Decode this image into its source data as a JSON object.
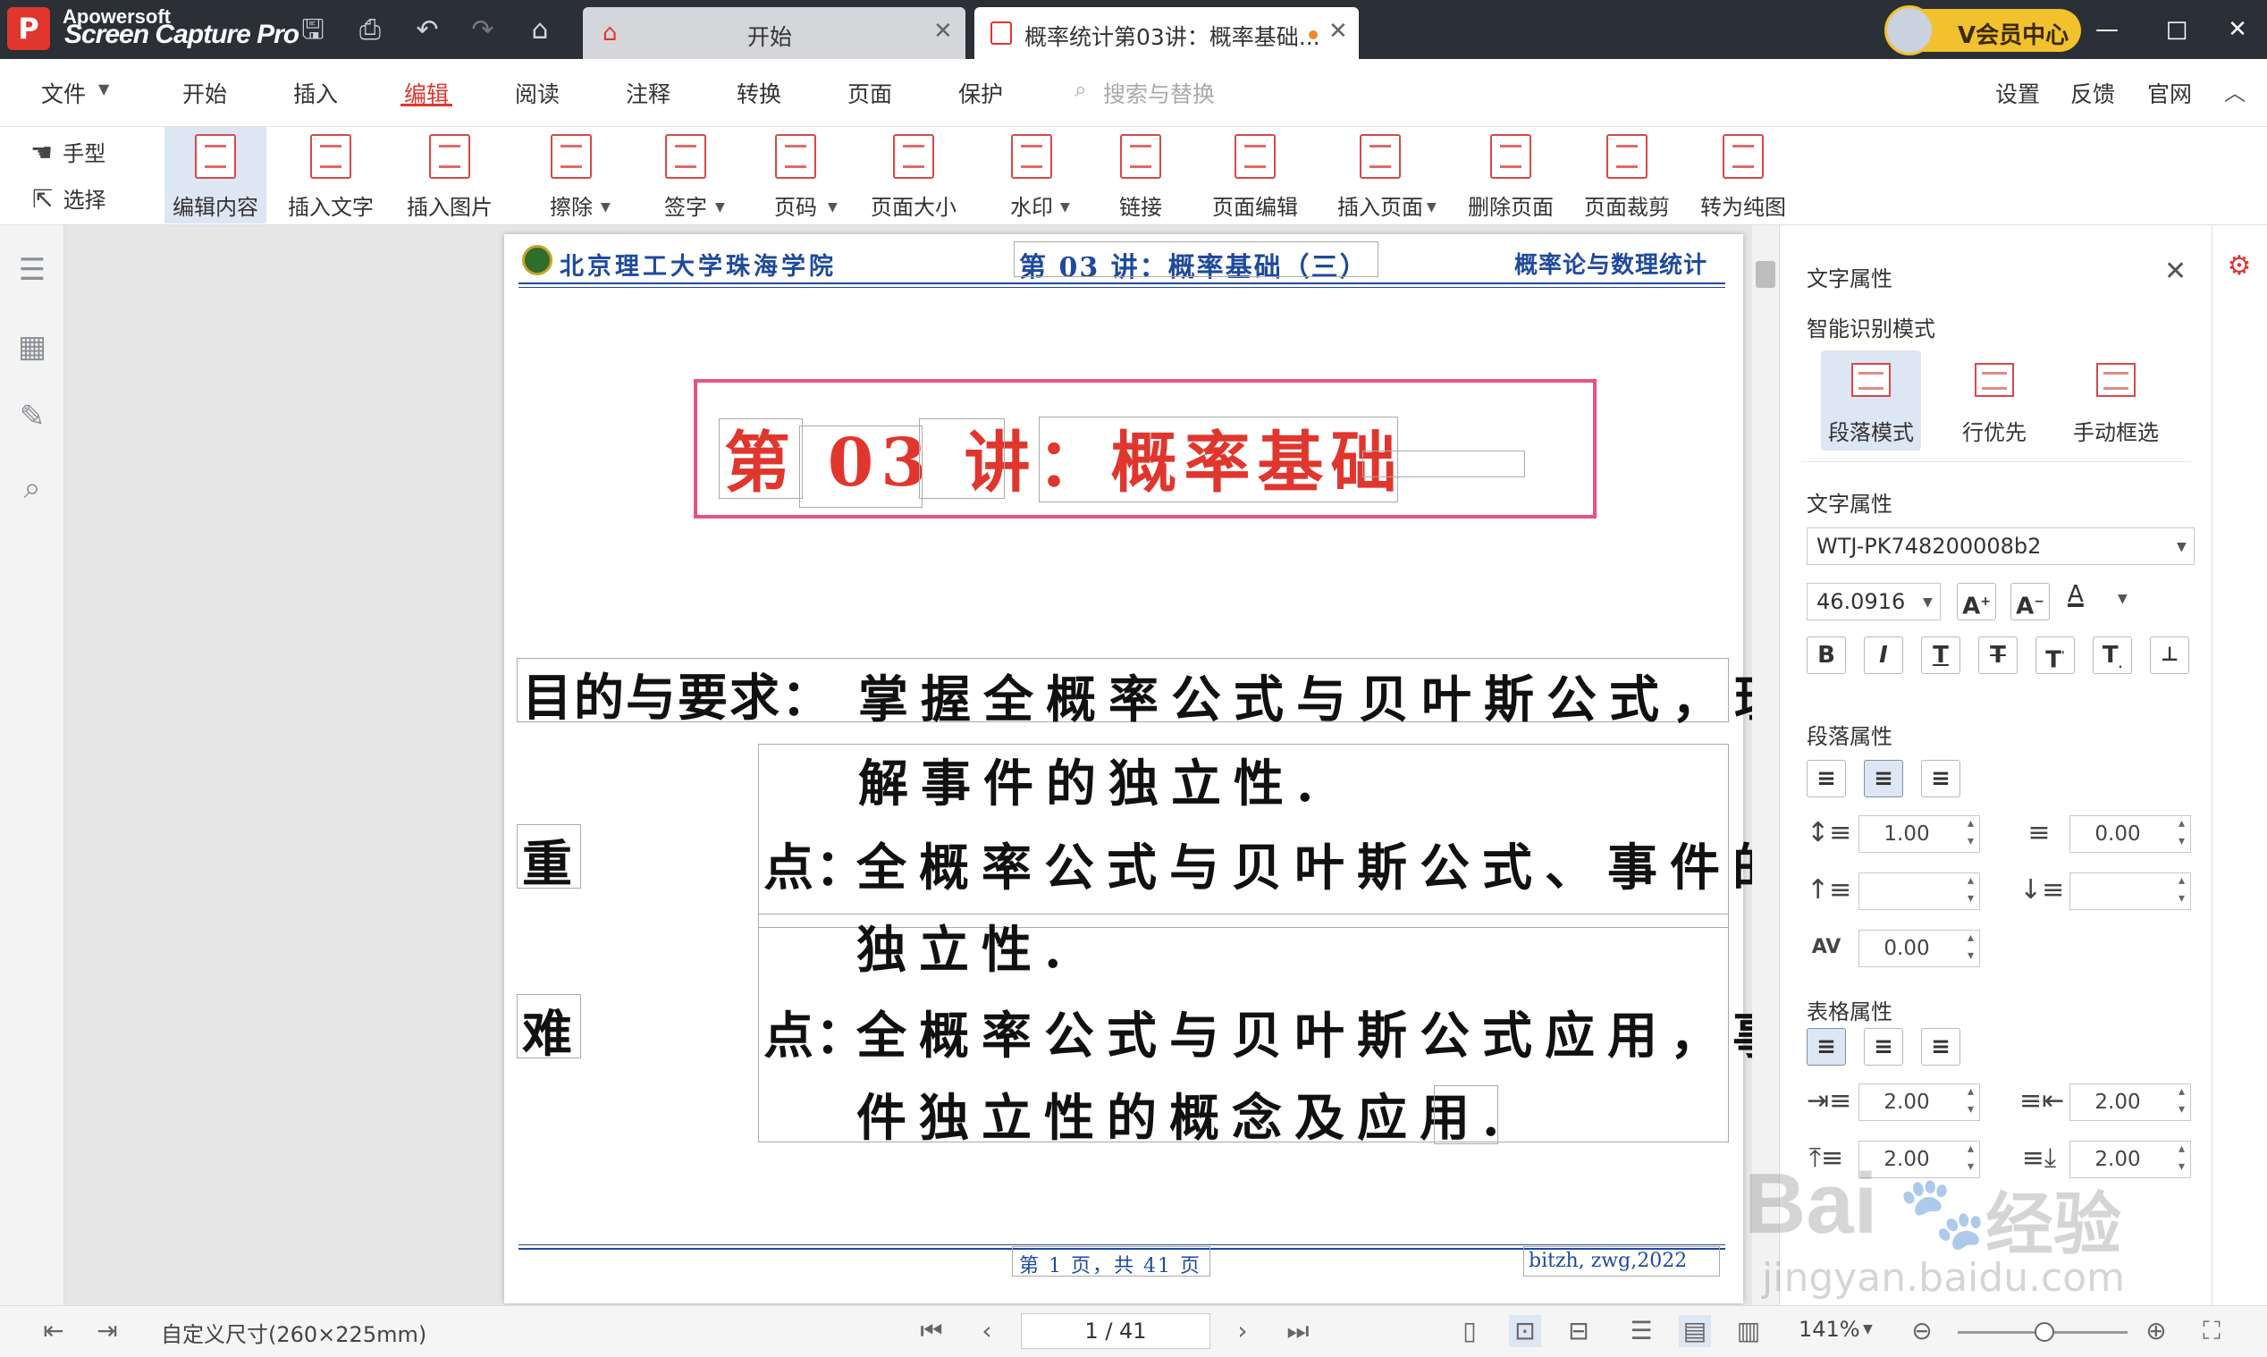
{
  "window": {
    "watermark_line1": "Apowersoft",
    "watermark_line2": "Screen Capture Pro",
    "tabs": [
      {
        "label": "开始"
      },
      {
        "label": "概率统计第03讲：概率基础..."
      }
    ],
    "vip_label": "V会员中心",
    "controls": {
      "minimize": "—",
      "maximize": "□",
      "close": "✕"
    }
  },
  "menu": {
    "items": [
      "文件",
      "开始",
      "插入",
      "编辑",
      "阅读",
      "注释",
      "转换",
      "页面",
      "保护"
    ],
    "active": "编辑",
    "search_placeholder": "搜索与替换",
    "right_items": [
      "设置",
      "反馈",
      "官网"
    ]
  },
  "toolbar": {
    "hand_label": "手型",
    "select_label": "选择",
    "tools": [
      "编辑内容",
      "插入文字",
      "插入图片",
      "擦除",
      "签字",
      "页码",
      "页面大小",
      "水印",
      "链接",
      "页面编辑",
      "插入页面",
      "删除页面",
      "页面裁剪",
      "转为纯图"
    ],
    "active_tool": "编辑内容"
  },
  "document": {
    "header_left": "北京理工大学珠海学院",
    "header_center": "第 03 讲：概率基础（三）",
    "header_right": "概率论与数理统计",
    "title": "第 03 讲：概率基础",
    "goal_label": "目的与要求：",
    "goal_line1": "掌握全概率公式与贝叶斯公式，理",
    "goal_line2": "解事件的独立性.",
    "key_label_1": "重",
    "key_label_2": "点：",
    "key_line1": "全概率公式与贝叶斯公式、事件的",
    "key_line2": "独立性.",
    "diff_label_1": "难",
    "diff_label_2": "点：",
    "diff_line1": "全概率公式与贝叶斯公式应用，事",
    "diff_line2": "件独立性的概念及应用.",
    "footer_center": "第 1 页，共 41 页",
    "footer_right": "bitzh, zwg,2022"
  },
  "panel": {
    "title": "文字属性",
    "smart_mode_label": "智能识别模式",
    "modes": [
      "段落模式",
      "行优先",
      "手动框选"
    ],
    "active_mode": "段落模式",
    "text_props_label": "文字属性",
    "font_name": "WTJ-PK748200008b2",
    "font_size": "46.0916",
    "para_props_label": "段落属性",
    "line_spacing": "1.00",
    "para_spacing": "0.00",
    "char_spacing": "0.00",
    "table_props_label": "表格属性",
    "table_margins": [
      "2.00",
      "2.00",
      "2.00",
      "2.00"
    ]
  },
  "status": {
    "page_size": "自定义尺寸(260×225mm)",
    "page_indicator": "1 / 41",
    "zoom": "141%"
  },
  "overlay": {
    "baidu_brand": "Bai",
    "baidu_text": "经验",
    "baidu_url": "jingyan.baidu.com"
  },
  "colors": {
    "titlebar": "#2b2f36",
    "accent_red": "#e0362e",
    "title_box": "#e8508a",
    "header_blue": "#1f4a9c",
    "vip": "#f2c12e"
  }
}
